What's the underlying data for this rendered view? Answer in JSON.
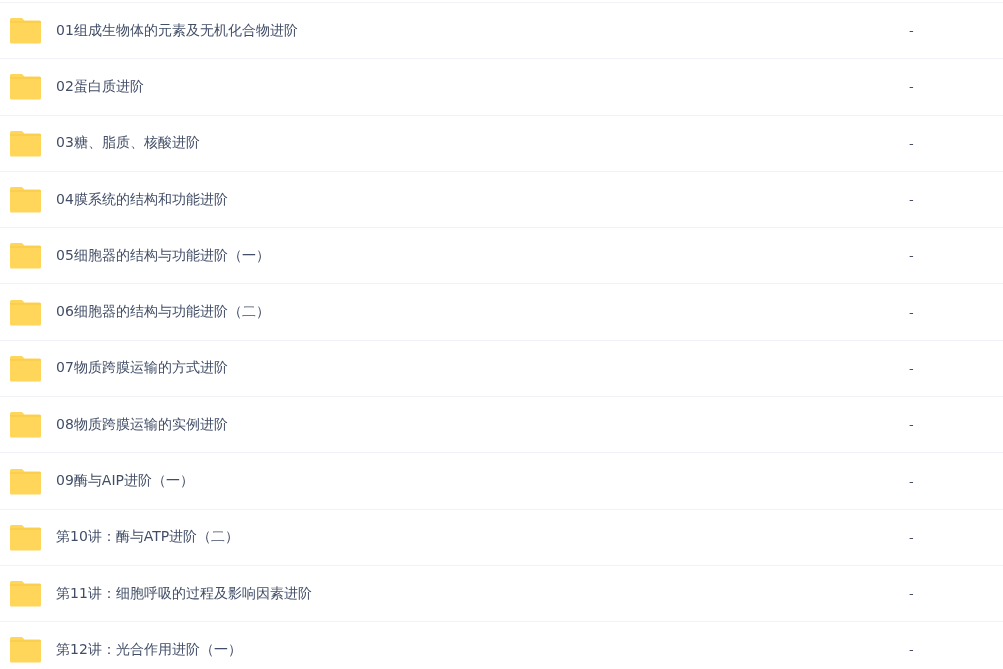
{
  "files": [
    {
      "name": "01组成生物体的元素及无机化合物进阶",
      "size": "-"
    },
    {
      "name": "02蛋白质进阶",
      "size": "-"
    },
    {
      "name": "03糖、脂质、核酸进阶",
      "size": "-"
    },
    {
      "name": "04膜系统的结构和功能进阶",
      "size": "-"
    },
    {
      "name": "05细胞器的结构与功能进阶（一）",
      "size": "-"
    },
    {
      "name": "06细胞器的结构与功能进阶（二）",
      "size": "-"
    },
    {
      "name": "07物质跨膜运输的方式进阶",
      "size": "-"
    },
    {
      "name": "08物质跨膜运输的实例进阶",
      "size": "-"
    },
    {
      "name": "09酶与AIP进阶（一）",
      "size": "-"
    },
    {
      "name": "第10讲：酶与ATP进阶（二）",
      "size": "-"
    },
    {
      "name": "第11讲：细胞呼吸的过程及影响因素进阶",
      "size": "-"
    },
    {
      "name": "第12讲：光合作用进阶（一）",
      "size": "-"
    }
  ]
}
